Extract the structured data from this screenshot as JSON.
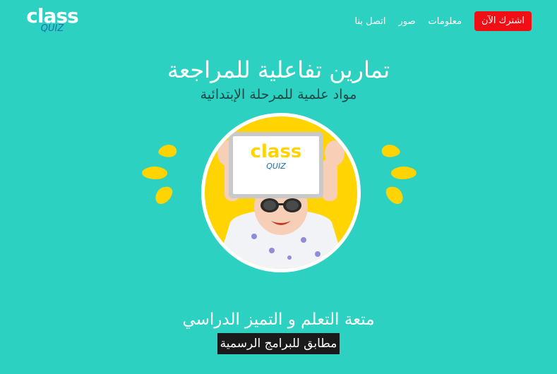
{
  "logo": {
    "top": "class",
    "bottom": "QUIZ"
  },
  "nav": {
    "cta": "اشترك الآن",
    "links": [
      "معلومات",
      "صور",
      "اتصل بنا"
    ]
  },
  "hero": {
    "title": "تمارين تفاعلية للمراجعة",
    "subtitle": "مواد علمية للمرحلة الإبتدائية",
    "tablet_logo_top": "class",
    "tablet_logo_bottom": "QUIZ"
  },
  "footer": {
    "line1": "متعة التعلم و التميز الدراسي",
    "line2": "مطابق للبرامج الرسمية"
  },
  "colors": {
    "background": "#2dd1c2",
    "cta": "#f10f16",
    "accent_yellow": "#ffd400"
  }
}
